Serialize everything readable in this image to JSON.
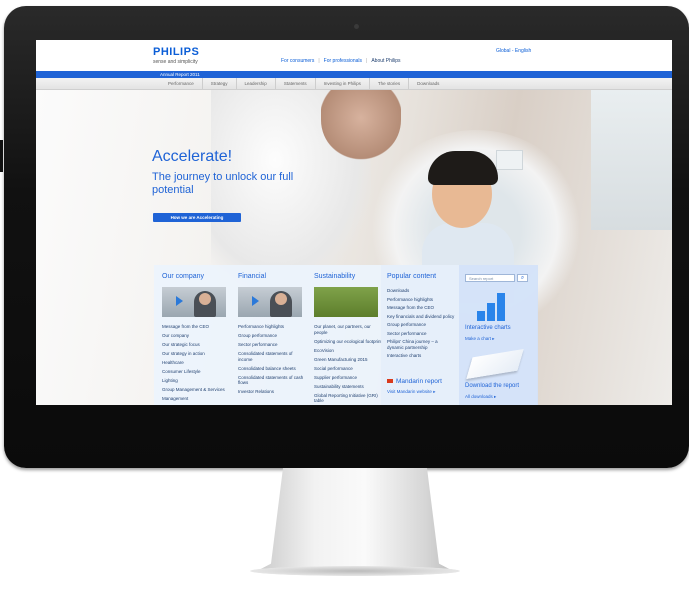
{
  "header": {
    "logo": "PHILIPS",
    "tagline": "sense and simplicity",
    "nav": [
      "For consumers",
      "For professionals",
      "About Philips"
    ],
    "region": "Global - English"
  },
  "band_label": "Annual Report 2011",
  "subnav": [
    "Performance",
    "Strategy",
    "Leadership",
    "Statements",
    "Investing in Philips",
    "The stories",
    "Downloads"
  ],
  "hero": {
    "title": "Accelerate!",
    "subtitle": "The journey to unlock our full potential",
    "cta": "How we are Accelerating"
  },
  "columns": [
    {
      "title": "Our company",
      "items": [
        "Message from the CEO",
        "Our company",
        "Our strategic focus",
        "Our strategy in action",
        "Healthcare",
        "Consumer Lifestyle",
        "Lighting",
        "Group Management & Services",
        "Management"
      ]
    },
    {
      "title": "Financial",
      "items": [
        "Performance highlights",
        "Group performance",
        "Sector performance",
        "Consolidated statements of income",
        "Consolidated balance sheets",
        "Consolidated statements of cash flows",
        "Investor Relations"
      ]
    },
    {
      "title": "Sustainability",
      "items": [
        "Our planet, our partners, our people",
        "Optimizing our ecological footprint",
        "EcoVision",
        "Green Manufacturing 2015",
        "Social performance",
        "Supplier performance",
        "Sustainability statements",
        "Global Reporting Initiative (GRI) table"
      ]
    }
  ],
  "popular": {
    "title": "Popular content",
    "items": [
      "Downloads",
      "Performance highlights",
      "Message from the CEO",
      "Key financials and dividend policy",
      "Group performance",
      "Sector performance",
      "Philips' China journey – a dynamic partnership",
      "Interactive charts"
    ],
    "mandarin": "Mandarin report",
    "mandarin_link": "Visit Mandarin website ▸"
  },
  "side": {
    "search_placeholder": "Search report",
    "charts_title": "Interactive charts",
    "charts_link": "Make a chart ▸",
    "download_title": "Download the report",
    "download_link": "All downloads ▸"
  }
}
